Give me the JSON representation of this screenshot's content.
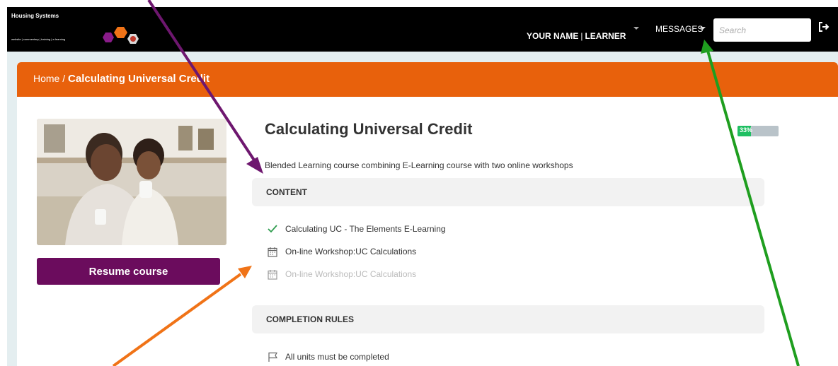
{
  "header": {
    "logo_title": "Housing Systems",
    "logo_subtitle": "website | commentary | training | e-learning",
    "user_name": "YOUR NAME",
    "user_role": "LEARNER",
    "messages_label": "MESSAGES",
    "search_placeholder": "Search",
    "icons": [
      "chevron-down-icon",
      "logout-icon"
    ]
  },
  "breadcrumb": {
    "home": "Home",
    "separator": "/",
    "current": "Calculating Universal Credit"
  },
  "course": {
    "title": "Calculating Universal Credit",
    "description": "Blended Learning course combining E-Learning course with two online workshops",
    "progress_percent": 33,
    "progress_label": "33%",
    "resume_label": "Resume course"
  },
  "content": {
    "heading": "CONTENT",
    "units": [
      {
        "label": "Calculating UC - The Elements E-Learning",
        "icon": "checkmark-icon",
        "state": "completed"
      },
      {
        "label": "On-line Workshop:UC Calculations",
        "icon": "calendar-icon",
        "state": "available"
      },
      {
        "label": "On-line Workshop:UC Calculations",
        "icon": "calendar-icon",
        "state": "disabled"
      }
    ]
  },
  "completion": {
    "heading": "COMPLETION RULES",
    "rules": [
      {
        "label": "All units must be completed",
        "icon": "flag-icon"
      }
    ]
  },
  "colors": {
    "topbar": "#000000",
    "header_orange": "#e8610c",
    "button_purple": "#6b0c5d",
    "progress_green": "#1fbf62",
    "check_green": "#2e9c4e",
    "arrow_purple": "#6e176f",
    "arrow_orange": "#f07317",
    "arrow_green": "#1f9e1f"
  }
}
